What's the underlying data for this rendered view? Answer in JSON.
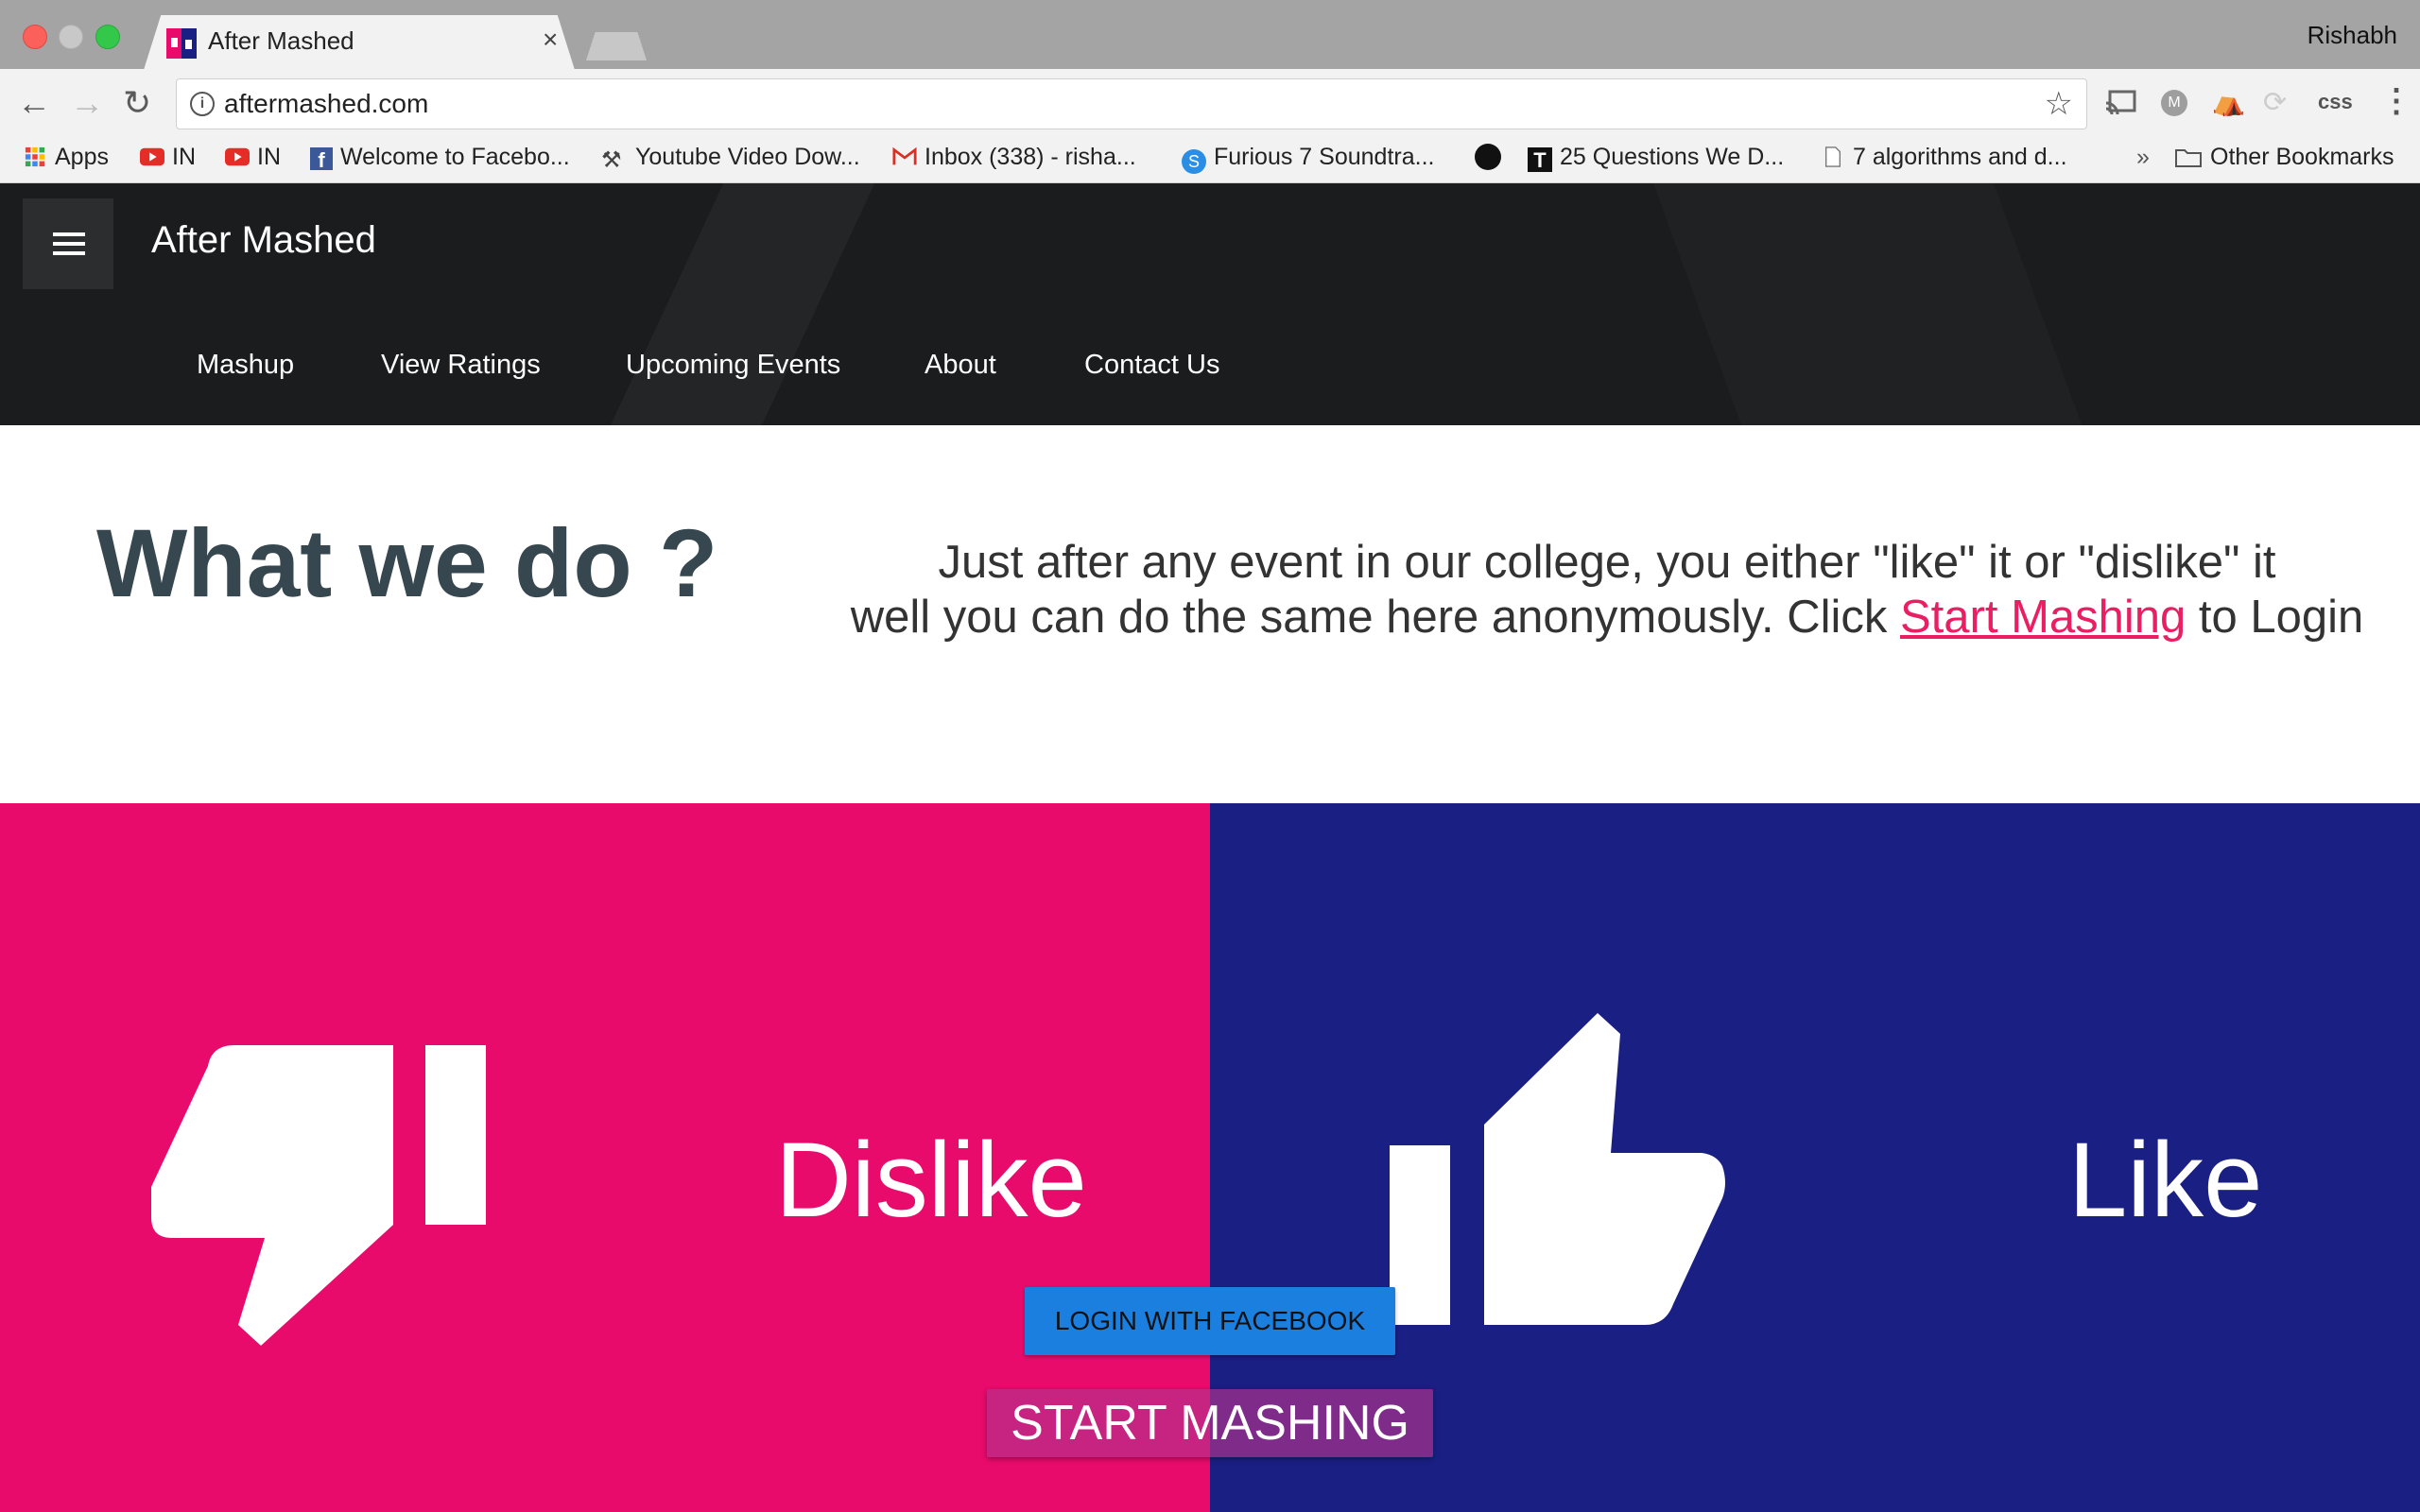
{
  "browser": {
    "tab_title": "After Mashed",
    "tab_close": "×",
    "profile_name": "Rishabh",
    "url": "aftermashed.com",
    "extensions": [
      "cast-icon",
      "m-icon",
      "island-icon",
      "swirl-icon",
      "css-icon",
      "menu-dots-icon"
    ],
    "ext_css_label": "css"
  },
  "bookmarks": [
    {
      "label": "Apps",
      "icon": "apps-grid-icon"
    },
    {
      "label": "IN",
      "icon": "youtube-icon"
    },
    {
      "label": "IN",
      "icon": "youtube-icon"
    },
    {
      "label": "Welcome to Facebo...",
      "icon": "facebook-icon"
    },
    {
      "label": "Youtube Video Dow...",
      "icon": "pickaxe-icon"
    },
    {
      "label": "Inbox (338) - risha...",
      "icon": "gmail-icon"
    },
    {
      "label": "Furious 7 Soundtra...",
      "icon": "shazam-icon"
    },
    {
      "label": "",
      "icon": "github-icon"
    },
    {
      "label": "25 Questions We D...",
      "icon": "t-icon"
    },
    {
      "label": "7 algorithms and d...",
      "icon": "page-icon"
    }
  ],
  "bookmarks_overflow": "»",
  "other_bookmarks": "Other Bookmarks",
  "site": {
    "brand": "After Mashed",
    "nav": [
      "Mashup",
      "View Ratings",
      "Upcoming Events",
      "About",
      "Contact Us"
    ],
    "what_title": "What we do ?",
    "what_line1": "Just after any event in our college, you either \"like\" it or \"dislike\" it",
    "what_line2_pre": "well you can do the same here anonymously. Click ",
    "what_link": "Start Mashing",
    "what_line2_post": " to Login",
    "dislike_label": "Dislike",
    "like_label": "Like",
    "fb_button": "LOGIN WITH FACEBOOK",
    "start_button": "START MASHING",
    "colors": {
      "dislike_bg": "#e90b6c",
      "like_bg": "#1a1f83",
      "header_bg": "#1b1c1e",
      "link": "#e91e63",
      "fb_button": "#1b7fe0"
    }
  }
}
